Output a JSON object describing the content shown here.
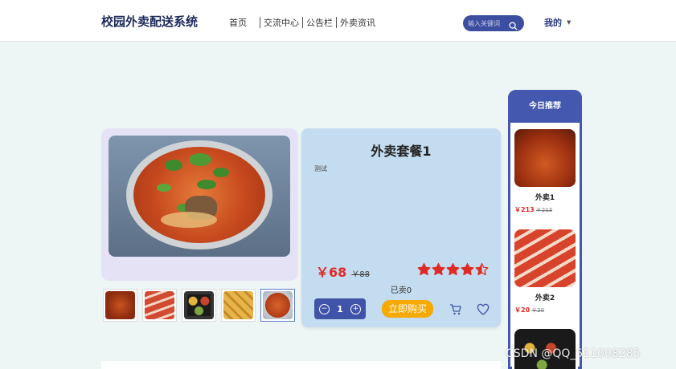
{
  "brand": "校园外卖配送系统",
  "nav": {
    "items": [
      "首页",
      "交流中心",
      "公告栏",
      "外卖资讯"
    ]
  },
  "search": {
    "placeholder": "输入关键词"
  },
  "user_menu": "我的",
  "product": {
    "title": "外卖套餐1",
    "description": "测试",
    "price": "￥68",
    "original_price": "￥88",
    "rating": 4.5,
    "sold": "已卖0",
    "quantity": "1",
    "buy_label": "立即购买"
  },
  "thumbnails": [
    {
      "kind": "skewers"
    },
    {
      "kind": "meat-rolls"
    },
    {
      "kind": "bento-box"
    },
    {
      "kind": "fried-tofu"
    },
    {
      "kind": "noodle-soup",
      "active": true
    }
  ],
  "recommend": {
    "title": "今日推荐",
    "items": [
      {
        "name": "外卖1",
        "price": "￥213",
        "old_price": "￥213"
      },
      {
        "name": "外卖2",
        "price": "￥20",
        "old_price": "￥20"
      }
    ]
  },
  "watermark": "CSDN @QQ_511008285",
  "colors": {
    "accent": "#4358ae",
    "price": "#e02a26",
    "buy": "#f6a900"
  }
}
